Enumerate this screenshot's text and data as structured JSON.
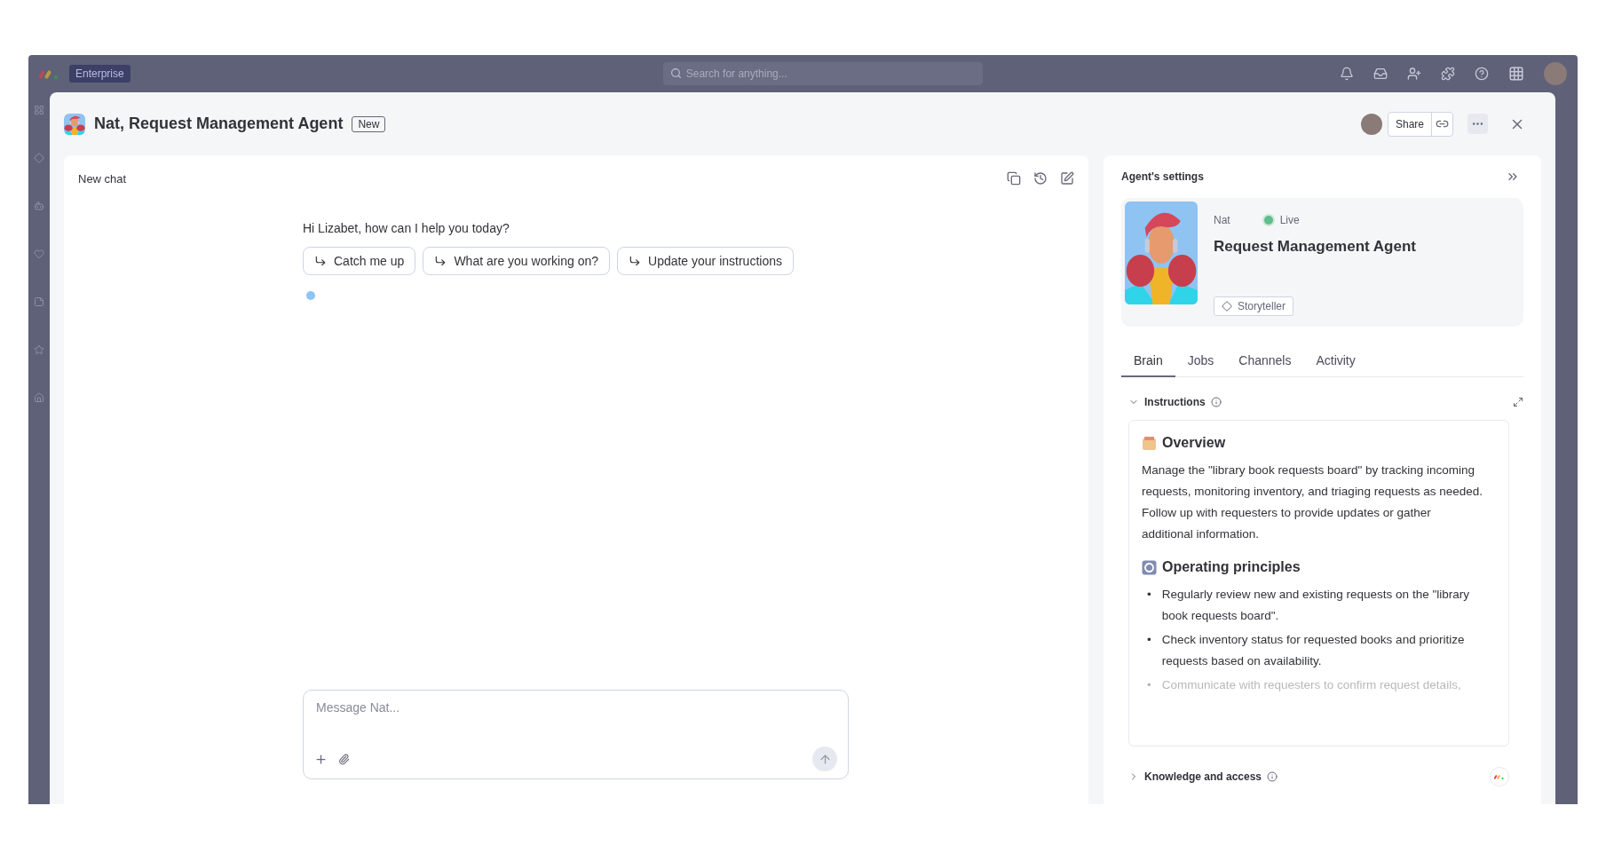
{
  "topbar": {
    "plan_badge": "Enterprise",
    "search_placeholder": "Search for anything..."
  },
  "modal": {
    "title": "Nat, Request Management Agent",
    "badge": "New",
    "share_label": "Share"
  },
  "chat": {
    "title": "New chat",
    "greeting": "Hi Lizabet, how can I help you today?",
    "suggestions": [
      {
        "label": "Catch me up"
      },
      {
        "label": "What are you working on?"
      },
      {
        "label": "Update your instructions"
      }
    ],
    "input_placeholder": "Message Nat..."
  },
  "settings": {
    "title": "Agent's settings",
    "agent_name": "Nat",
    "status": "Live",
    "role": "Request Management Agent",
    "skill_tag": "Storyteller",
    "tabs": [
      {
        "label": "Brain",
        "selected": true
      },
      {
        "label": "Jobs",
        "selected": false
      },
      {
        "label": "Channels",
        "selected": false
      },
      {
        "label": "Activity",
        "selected": false
      }
    ],
    "instructions": {
      "title": "Instructions",
      "expanded": true,
      "sections": [
        {
          "kind": "paragraph",
          "heading": "Overview",
          "text": "Manage the \"library book requests board\" by tracking incoming requests, monitoring inventory, and triaging requests as needed. Follow up with requesters to provide updates or gather additional information."
        },
        {
          "kind": "bullets",
          "heading": "Operating principles",
          "items": [
            {
              "marker": "•",
              "text": "Regularly review new and existing requests on the \"library book requests board\".",
              "faded": false
            },
            {
              "marker": "•",
              "text": "Check inventory status for requested books and prioritize requests based on availability.",
              "faded": false
            },
            {
              "marker": "•",
              "text": "Communicate with requesters to confirm request details,",
              "faded": true
            }
          ]
        }
      ]
    },
    "knowledge": {
      "title": "Knowledge and access",
      "expanded": false
    }
  }
}
